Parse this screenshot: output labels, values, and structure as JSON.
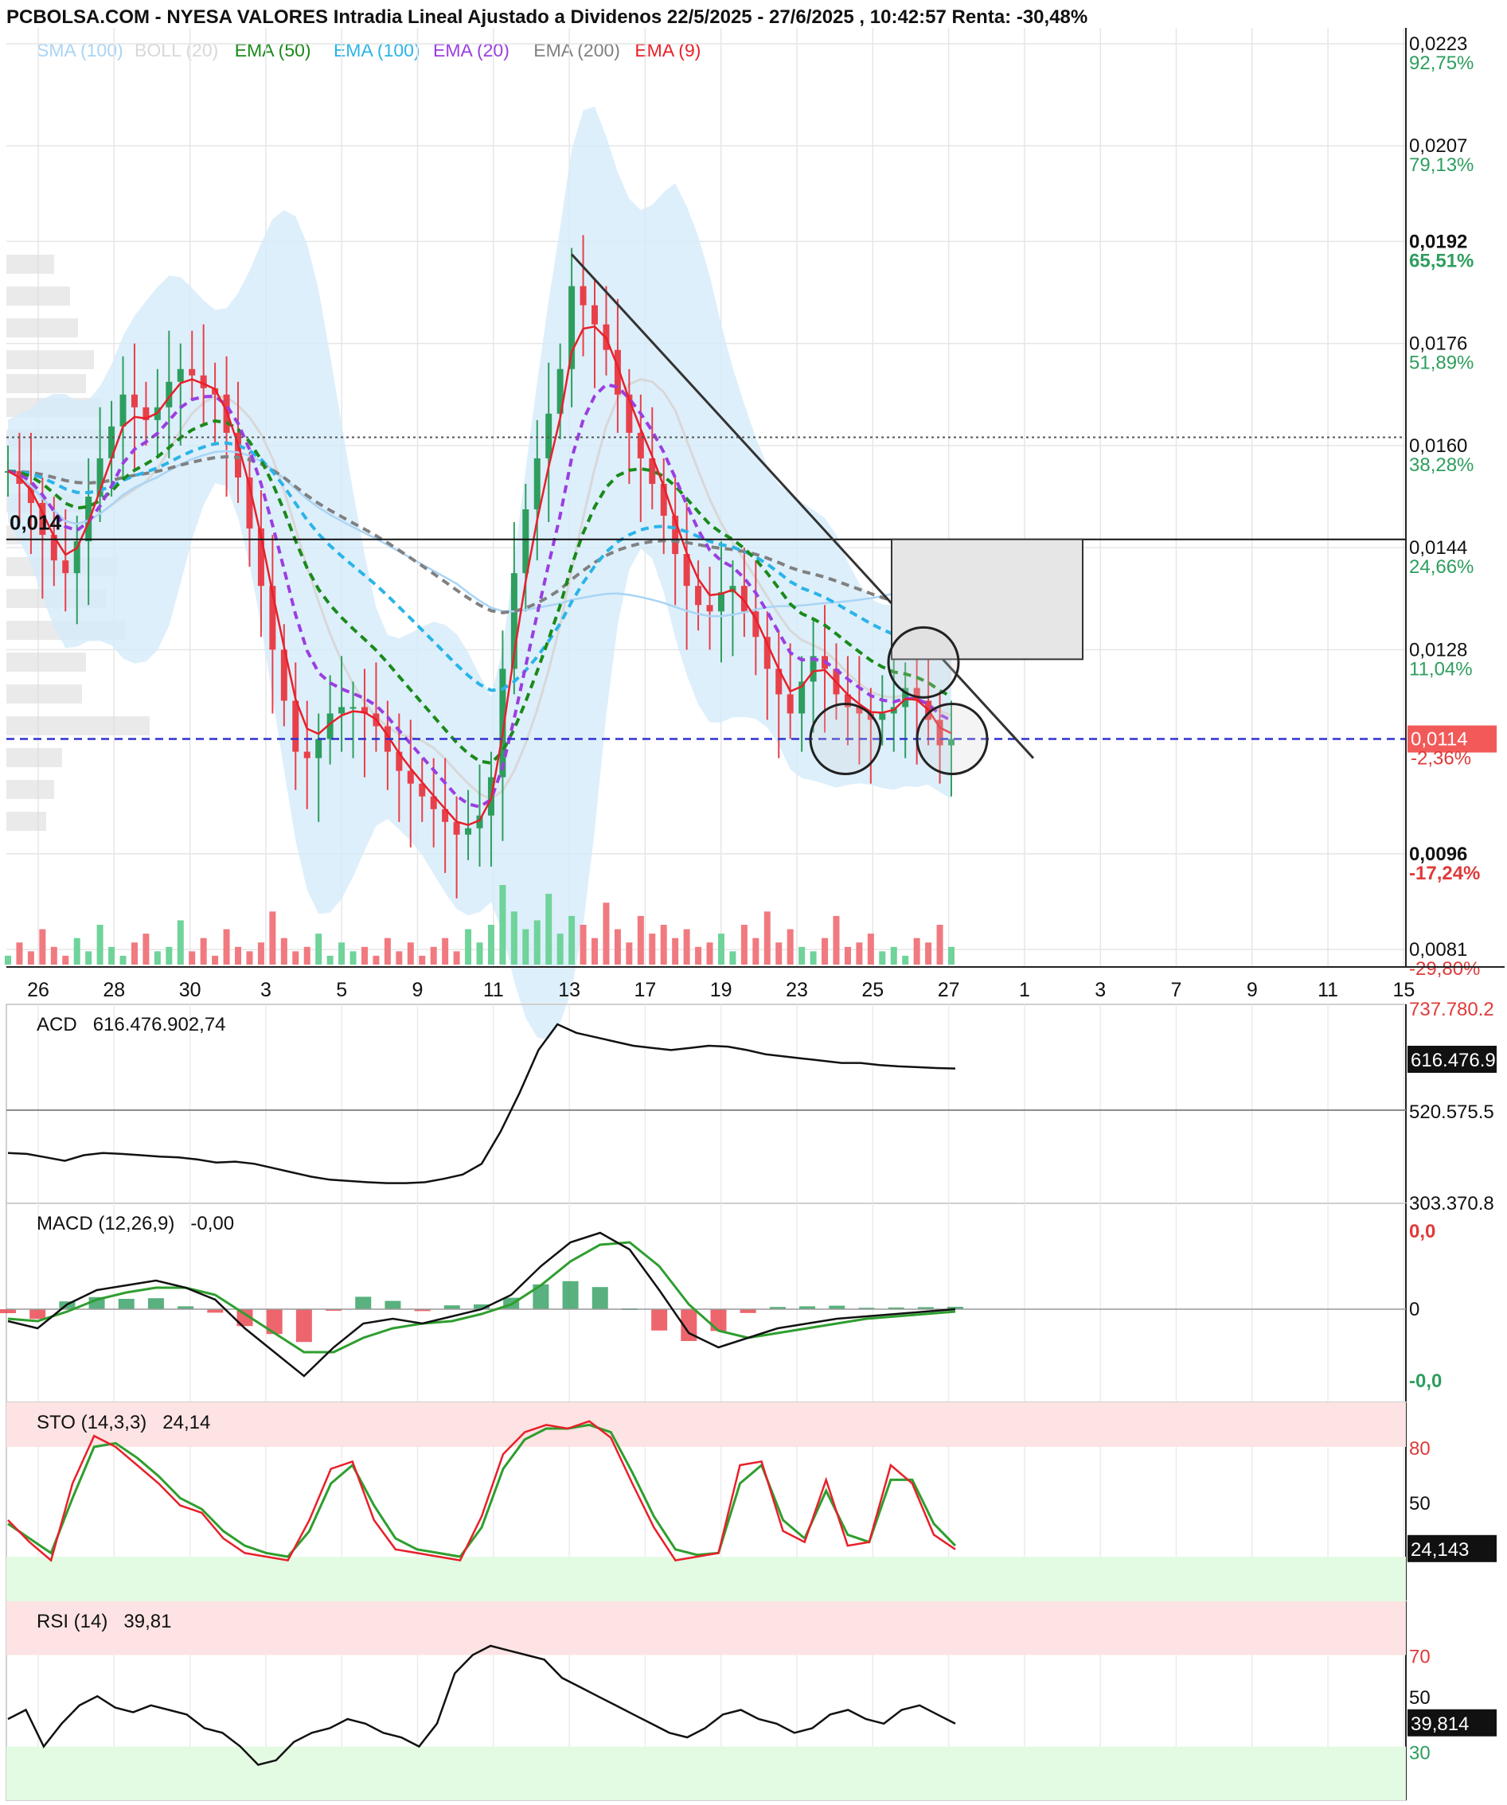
{
  "header": {
    "title": "PCBOLSA.COM - NYESA VALORES Intradia Lineal Ajustado a Dividenos 22/5/2025 - 27/6/2025 , 10:42:57 Renta: -30,48%"
  },
  "legend": [
    {
      "label": "SMA (100)",
      "color": "#a9d4f5"
    },
    {
      "label": "BOLL (20)",
      "color": "#d8d8d8"
    },
    {
      "label": "EMA (50)",
      "color": "#1a8a1a"
    },
    {
      "label": "EMA (100)",
      "color": "#2ab4e8"
    },
    {
      "label": "EMA (20)",
      "color": "#9a3ee0"
    },
    {
      "label": "EMA (200)",
      "color": "#808080"
    },
    {
      "label": "EMA (9)",
      "color": "#e8202a"
    }
  ],
  "colors": {
    "up": "#2e9e5e",
    "down": "#e8404a",
    "vol_up": "#6fd39a",
    "vol_down": "#f07a80",
    "boll_fill": "#d4ebfa",
    "price_tag": "#f25a5a",
    "overbought": "#fde3e3",
    "oversold": "#e3fbe3"
  },
  "chart_data": [
    {
      "type": "candlestick",
      "title": "NYESA VALORES",
      "x_ticks": [
        "26",
        "28",
        "30",
        "3",
        "5",
        "9",
        "11",
        "13",
        "17",
        "19",
        "23",
        "25",
        "27",
        "1",
        "3",
        "7",
        "9",
        "11",
        "15"
      ],
      "y_ticks": [
        {
          "price": "0,0223",
          "pct": "92,75%"
        },
        {
          "price": "0,0207",
          "pct": "79,13%"
        },
        {
          "price": "0,0192",
          "pct": "65,51%"
        },
        {
          "price": "0,0176",
          "pct": "51,89%"
        },
        {
          "price": "0,0160",
          "pct": "38,28%"
        },
        {
          "price": "0,0144",
          "pct": "24,66%"
        },
        {
          "price": "0,0128",
          "pct": "11,04%"
        },
        {
          "price": "0,0096",
          "pct": "-17,24%"
        },
        {
          "price": "0,0081",
          "pct": "-29,80%"
        }
      ],
      "ylim": [
        0.0081,
        0.0223
      ],
      "last_price": "0,0114",
      "last_pct": "-2,36%",
      "support_label": "0,014",
      "support_level": 0.01453,
      "dotted_level": 0.01613,
      "current_level": 0.0114,
      "close_series": [
        0.0156,
        0.0154,
        0.0151,
        0.0146,
        0.0142,
        0.014,
        0.0145,
        0.0152,
        0.0158,
        0.0163,
        0.0168,
        0.0166,
        0.0164,
        0.0166,
        0.017,
        0.0172,
        0.0171,
        0.0169,
        0.0168,
        0.0162,
        0.0155,
        0.0147,
        0.0138,
        0.0128,
        0.012,
        0.0112,
        0.0111,
        0.0114,
        0.0118,
        0.0119,
        0.0119,
        0.0118,
        0.0116,
        0.0112,
        0.0109,
        0.0107,
        0.0105,
        0.0103,
        0.0101,
        0.0099,
        0.01,
        0.0102,
        0.0108,
        0.0125,
        0.014,
        0.015,
        0.0158,
        0.0165,
        0.0172,
        0.0185,
        0.0182,
        0.0179,
        0.0175,
        0.0168,
        0.0162,
        0.0158,
        0.0154,
        0.0149,
        0.0143,
        0.0138,
        0.0135,
        0.0134,
        0.0137,
        0.0138,
        0.0134,
        0.013,
        0.0125,
        0.0121,
        0.0118,
        0.0123,
        0.0127,
        0.0125,
        0.0121,
        0.0119,
        0.0118,
        0.0117,
        0.0118,
        0.0119,
        0.0122,
        0.012,
        0.0117,
        0.0113,
        0.0114
      ],
      "volume_series": [
        2,
        5,
        3,
        8,
        4,
        2,
        6,
        3,
        9,
        4,
        2,
        5,
        7,
        3,
        4,
        10,
        3,
        6,
        2,
        8,
        4,
        3,
        5,
        12,
        6,
        3,
        4,
        7,
        2,
        5,
        3,
        4,
        2,
        6,
        3,
        5,
        2,
        4,
        6,
        3,
        8,
        5,
        9,
        18,
        12,
        8,
        10,
        16,
        7,
        11,
        9,
        6,
        14,
        8,
        5,
        11,
        7,
        9,
        6,
        8,
        4,
        5,
        7,
        3,
        9,
        6,
        12,
        5,
        8,
        4,
        3,
        6,
        11,
        4,
        5,
        7,
        3,
        4,
        2,
        6,
        5,
        9,
        4
      ]
    },
    {
      "type": "line",
      "title": "ACD",
      "value": "616.476.902,74",
      "tag": "616.476.9",
      "y_ticks": [
        "737.780.2",
        "520.575.5",
        "303.370.8"
      ],
      "ylim": [
        303370800,
        737780200
      ],
      "values": [
        420,
        418,
        410,
        402,
        415,
        420,
        418,
        415,
        412,
        410,
        405,
        398,
        400,
        395,
        385,
        375,
        365,
        358,
        355,
        352,
        350,
        350,
        352,
        360,
        370,
        395,
        470,
        560,
        660,
        720,
        700,
        690,
        680,
        670,
        665,
        660,
        665,
        670,
        668,
        660,
        650,
        645,
        640,
        635,
        630,
        630,
        625,
        622,
        620,
        618,
        617
      ]
    },
    {
      "type": "line",
      "title": "MACD (12,26,9)",
      "value": "-0,00",
      "y_ticks": [
        "0,0",
        "0",
        "-0,0"
      ],
      "macd": [
        -5,
        -8,
        2,
        8,
        10,
        12,
        9,
        4,
        -8,
        -18,
        -28,
        -16,
        -6,
        -4,
        -6,
        -3,
        0,
        6,
        18,
        28,
        32,
        25,
        8,
        -10,
        -16,
        -12,
        -8,
        -6,
        -4,
        -3,
        -2,
        -1,
        0
      ],
      "signal": [
        -4,
        -5,
        -1,
        4,
        7,
        9,
        9,
        6,
        -2,
        -10,
        -18,
        -18,
        -12,
        -8,
        -6,
        -5,
        -2,
        2,
        10,
        20,
        27,
        28,
        18,
        2,
        -9,
        -12,
        -10,
        -8,
        -6,
        -4,
        -3,
        -2,
        -1
      ]
    },
    {
      "type": "line",
      "title": "STO (14,3,3)",
      "value": "24,14",
      "tag": "24,143",
      "y_ticks": [
        "80",
        "50"
      ],
      "k": [
        40,
        28,
        18,
        60,
        86,
        80,
        70,
        60,
        48,
        44,
        30,
        22,
        20,
        18,
        40,
        68,
        72,
        40,
        24,
        22,
        20,
        18,
        42,
        76,
        88,
        92,
        90,
        94,
        85,
        60,
        36,
        18,
        20,
        22,
        70,
        72,
        34,
        28,
        62,
        26,
        28,
        70,
        60,
        32,
        24
      ],
      "d": [
        38,
        30,
        22,
        52,
        80,
        82,
        74,
        64,
        52,
        46,
        34,
        26,
        22,
        20,
        34,
        60,
        70,
        48,
        30,
        24,
        22,
        20,
        36,
        68,
        84,
        90,
        90,
        92,
        88,
        66,
        42,
        24,
        21,
        22,
        60,
        70,
        40,
        30,
        56,
        32,
        28,
        62,
        62,
        38,
        26
      ]
    },
    {
      "type": "line",
      "title": "RSI (14)",
      "value": "39,81",
      "tag": "39,814",
      "y_ticks": [
        "70",
        "50",
        "30"
      ],
      "values": [
        42,
        46,
        30,
        40,
        48,
        52,
        47,
        45,
        48,
        46,
        44,
        38,
        36,
        30,
        22,
        24,
        32,
        36,
        38,
        42,
        40,
        36,
        34,
        30,
        40,
        62,
        70,
        74,
        72,
        70,
        68,
        60,
        56,
        52,
        48,
        44,
        40,
        36,
        34,
        38,
        44,
        46,
        42,
        40,
        36,
        38,
        44,
        46,
        42,
        40,
        46,
        48,
        44,
        40
      ]
    }
  ]
}
